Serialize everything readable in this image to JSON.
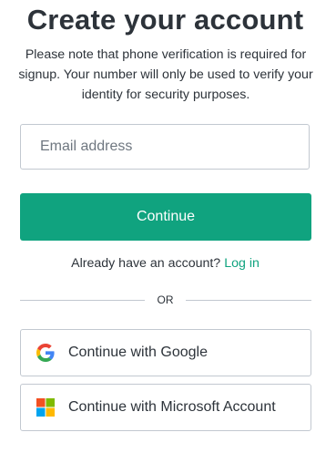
{
  "header": {
    "title": "Create your account",
    "notice": "Please note that phone verification is required for signup. Your number will only be used to verify your identity for security purposes."
  },
  "form": {
    "email_placeholder": "Email address",
    "email_value": "",
    "continue_label": "Continue"
  },
  "login": {
    "prompt": "Already have an account?",
    "link_label": "Log in"
  },
  "divider": {
    "label": "OR"
  },
  "social": {
    "google_label": "Continue with Google",
    "google_icon": "google-icon",
    "microsoft_label": "Continue with Microsoft Account",
    "microsoft_icon": "microsoft-icon"
  },
  "colors": {
    "accent": "#10a37f",
    "text": "#2d333a",
    "border": "#c2c8d0",
    "google_blue": "#4285f4",
    "google_red": "#ea4335",
    "google_yellow": "#fbbc05",
    "google_green": "#34a853",
    "ms_red": "#f25022",
    "ms_green": "#7fba00",
    "ms_blue": "#00a4ef",
    "ms_yellow": "#ffb900"
  }
}
